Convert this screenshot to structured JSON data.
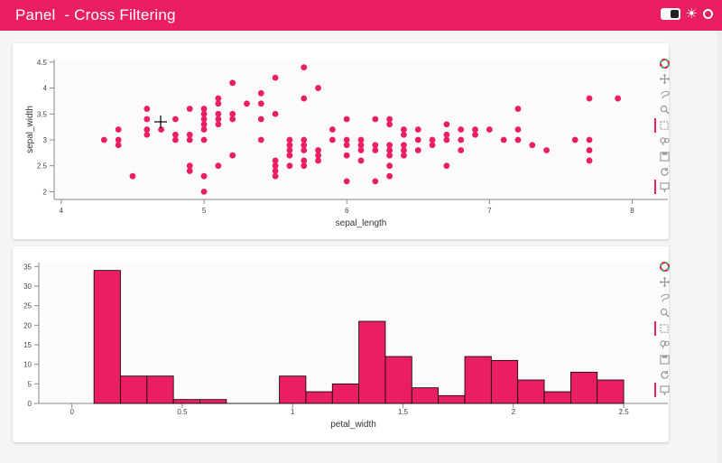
{
  "header": {
    "title": "Panel  - Cross Filtering",
    "bg": "#e91e63"
  },
  "accent": "#e91e63",
  "scatter": {
    "chart_data": {
      "type": "scatter",
      "xlabel": "sepal_length",
      "ylabel": "sepal_width",
      "xlim": [
        3.95,
        8.25
      ],
      "ylim": [
        1.85,
        4.55
      ],
      "xticks": [
        4,
        5,
        6,
        7,
        8
      ],
      "yticks": [
        2,
        2.5,
        3,
        3.5,
        4,
        4.5
      ],
      "ytick_labels": [
        "2",
        "2.5",
        "3",
        "3.5",
        "4",
        "4.5"
      ],
      "points": [
        [
          4.3,
          3.0
        ],
        [
          4.4,
          2.9
        ],
        [
          4.4,
          3.0
        ],
        [
          4.4,
          3.2
        ],
        [
          4.5,
          2.3
        ],
        [
          4.6,
          3.1
        ],
        [
          4.6,
          3.2
        ],
        [
          4.6,
          3.4
        ],
        [
          4.6,
          3.6
        ],
        [
          4.7,
          3.2
        ],
        [
          4.8,
          3.0
        ],
        [
          4.8,
          3.1
        ],
        [
          4.8,
          3.4
        ],
        [
          4.9,
          2.4
        ],
        [
          4.9,
          2.5
        ],
        [
          4.9,
          3.0
        ],
        [
          4.9,
          3.1
        ],
        [
          4.9,
          3.6
        ],
        [
          5.0,
          2.0
        ],
        [
          5.0,
          2.3
        ],
        [
          5.0,
          3.0
        ],
        [
          5.0,
          3.2
        ],
        [
          5.0,
          3.3
        ],
        [
          5.0,
          3.4
        ],
        [
          5.0,
          3.5
        ],
        [
          5.0,
          3.6
        ],
        [
          5.1,
          2.5
        ],
        [
          5.1,
          3.3
        ],
        [
          5.1,
          3.4
        ],
        [
          5.1,
          3.5
        ],
        [
          5.1,
          3.7
        ],
        [
          5.1,
          3.8
        ],
        [
          5.2,
          2.7
        ],
        [
          5.2,
          3.4
        ],
        [
          5.2,
          3.5
        ],
        [
          5.2,
          4.1
        ],
        [
          5.3,
          3.7
        ],
        [
          5.4,
          3.0
        ],
        [
          5.4,
          3.4
        ],
        [
          5.4,
          3.7
        ],
        [
          5.4,
          3.9
        ],
        [
          5.5,
          2.3
        ],
        [
          5.5,
          2.4
        ],
        [
          5.5,
          2.5
        ],
        [
          5.5,
          2.6
        ],
        [
          5.5,
          3.5
        ],
        [
          5.5,
          4.2
        ],
        [
          5.6,
          2.5
        ],
        [
          5.6,
          2.7
        ],
        [
          5.6,
          2.8
        ],
        [
          5.6,
          2.9
        ],
        [
          5.6,
          3.0
        ],
        [
          5.7,
          2.5
        ],
        [
          5.7,
          2.6
        ],
        [
          5.7,
          2.8
        ],
        [
          5.7,
          2.9
        ],
        [
          5.7,
          3.0
        ],
        [
          5.7,
          3.8
        ],
        [
          5.7,
          4.4
        ],
        [
          5.8,
          2.6
        ],
        [
          5.8,
          2.7
        ],
        [
          5.8,
          2.8
        ],
        [
          5.8,
          4.0
        ],
        [
          5.9,
          3.0
        ],
        [
          5.9,
          3.2
        ],
        [
          6.0,
          2.2
        ],
        [
          6.0,
          2.7
        ],
        [
          6.0,
          2.9
        ],
        [
          6.0,
          3.0
        ],
        [
          6.0,
          3.4
        ],
        [
          6.1,
          2.6
        ],
        [
          6.1,
          2.8
        ],
        [
          6.1,
          2.9
        ],
        [
          6.1,
          3.0
        ],
        [
          6.2,
          2.2
        ],
        [
          6.2,
          2.8
        ],
        [
          6.2,
          2.9
        ],
        [
          6.2,
          3.4
        ],
        [
          6.3,
          2.3
        ],
        [
          6.3,
          2.5
        ],
        [
          6.3,
          2.7
        ],
        [
          6.3,
          2.8
        ],
        [
          6.3,
          2.9
        ],
        [
          6.3,
          3.3
        ],
        [
          6.3,
          3.4
        ],
        [
          6.4,
          2.7
        ],
        [
          6.4,
          2.8
        ],
        [
          6.4,
          2.9
        ],
        [
          6.4,
          3.1
        ],
        [
          6.4,
          3.2
        ],
        [
          6.5,
          2.8
        ],
        [
          6.5,
          3.0
        ],
        [
          6.5,
          3.2
        ],
        [
          6.6,
          2.9
        ],
        [
          6.6,
          3.0
        ],
        [
          6.7,
          2.5
        ],
        [
          6.7,
          3.0
        ],
        [
          6.7,
          3.1
        ],
        [
          6.7,
          3.3
        ],
        [
          6.8,
          2.8
        ],
        [
          6.8,
          3.0
        ],
        [
          6.8,
          3.2
        ],
        [
          6.9,
          3.1
        ],
        [
          6.9,
          3.2
        ],
        [
          7.0,
          3.2
        ],
        [
          7.1,
          3.0
        ],
        [
          7.2,
          3.0
        ],
        [
          7.2,
          3.2
        ],
        [
          7.2,
          3.6
        ],
        [
          7.3,
          2.9
        ],
        [
          7.4,
          2.8
        ],
        [
          7.6,
          3.0
        ],
        [
          7.7,
          2.6
        ],
        [
          7.7,
          2.8
        ],
        [
          7.7,
          3.0
        ],
        [
          7.7,
          3.8
        ],
        [
          7.9,
          3.8
        ]
      ]
    }
  },
  "histogram": {
    "chart_data": {
      "type": "bar",
      "xlabel": "petal_width",
      "ylabel": "",
      "xlim": [
        -0.15,
        2.7
      ],
      "ylim": [
        0,
        36
      ],
      "xticks": [
        0,
        0.5,
        1,
        1.5,
        2,
        2.5
      ],
      "xtick_labels": [
        "0",
        "0.5",
        "1",
        "1.5",
        "2",
        "2.5"
      ],
      "yticks": [
        0,
        5,
        10,
        15,
        20,
        25,
        30,
        35
      ],
      "bins": [
        {
          "x0": 0.1,
          "x1": 0.22,
          "count": 34
        },
        {
          "x0": 0.22,
          "x1": 0.34,
          "count": 7
        },
        {
          "x0": 0.34,
          "x1": 0.46,
          "count": 7
        },
        {
          "x0": 0.46,
          "x1": 0.58,
          "count": 1
        },
        {
          "x0": 0.58,
          "x1": 0.7,
          "count": 1
        },
        {
          "x0": 0.7,
          "x1": 0.82,
          "count": 0
        },
        {
          "x0": 0.82,
          "x1": 0.94,
          "count": 0
        },
        {
          "x0": 0.94,
          "x1": 1.06,
          "count": 7
        },
        {
          "x0": 1.06,
          "x1": 1.18,
          "count": 3
        },
        {
          "x0": 1.18,
          "x1": 1.3,
          "count": 5
        },
        {
          "x0": 1.3,
          "x1": 1.42,
          "count": 21
        },
        {
          "x0": 1.42,
          "x1": 1.54,
          "count": 12
        },
        {
          "x0": 1.54,
          "x1": 1.66,
          "count": 4
        },
        {
          "x0": 1.66,
          "x1": 1.78,
          "count": 2
        },
        {
          "x0": 1.78,
          "x1": 1.9,
          "count": 12
        },
        {
          "x0": 1.9,
          "x1": 2.02,
          "count": 11
        },
        {
          "x0": 2.02,
          "x1": 2.14,
          "count": 6
        },
        {
          "x0": 2.14,
          "x1": 2.26,
          "count": 3
        },
        {
          "x0": 2.26,
          "x1": 2.38,
          "count": 8
        },
        {
          "x0": 2.38,
          "x1": 2.5,
          "count": 6
        }
      ]
    }
  },
  "toolbar_icons": [
    "bokeh-logo-icon",
    "pan-icon",
    "lasso-select-icon",
    "zoom-icon",
    "box-select-icon",
    "wheel-zoom-icon",
    "save-icon",
    "reset-icon",
    "hover-icon"
  ]
}
